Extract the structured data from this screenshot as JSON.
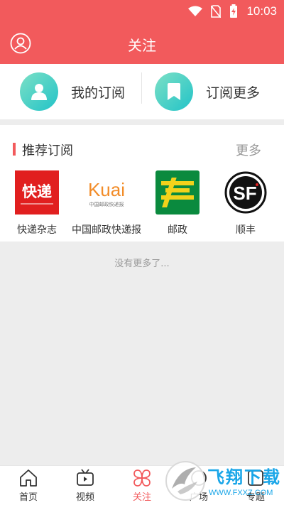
{
  "status_bar": {
    "time": "10:03",
    "icons": [
      "wifi-icon",
      "no-sim-icon",
      "battery-charging-icon"
    ]
  },
  "header": {
    "title": "关注",
    "profile_icon": "user-circle-icon",
    "background": "#f25a5c"
  },
  "subscriptions": {
    "my_label": "我的订阅",
    "more_label": "订阅更多",
    "my_icon": "person-icon",
    "more_icon": "bookmark-icon"
  },
  "recommended": {
    "title": "推荐订阅",
    "more": "更多",
    "items": [
      {
        "label": "快递杂志",
        "icon": "kuaidi-magazine-logo",
        "logo_text": "快递"
      },
      {
        "label": "中国邮政快递报",
        "icon": "kuai-logo",
        "logo_text": "Kuai",
        "logo_subtext": "中国邮政快递报"
      },
      {
        "label": "邮政",
        "icon": "china-post-logo"
      },
      {
        "label": "顺丰",
        "icon": "sf-express-logo",
        "logo_text": "SF"
      }
    ]
  },
  "feed": {
    "no_more": "没有更多了..."
  },
  "tabbar": {
    "tabs": [
      {
        "label": "首页",
        "icon": "home-icon"
      },
      {
        "label": "视频",
        "icon": "tv-icon"
      },
      {
        "label": "关注",
        "icon": "clover-icon",
        "active": true
      },
      {
        "label": "广场",
        "icon": "plaza-icon"
      },
      {
        "label": "专题",
        "icon": "topic-icon"
      }
    ]
  },
  "watermark": {
    "text": "飞翔下载",
    "url": "WWW.FXXZ.COM"
  },
  "colors": {
    "accent": "#f25a5c",
    "teal": "#22c3c8",
    "post_green": "#0a8a3e"
  }
}
